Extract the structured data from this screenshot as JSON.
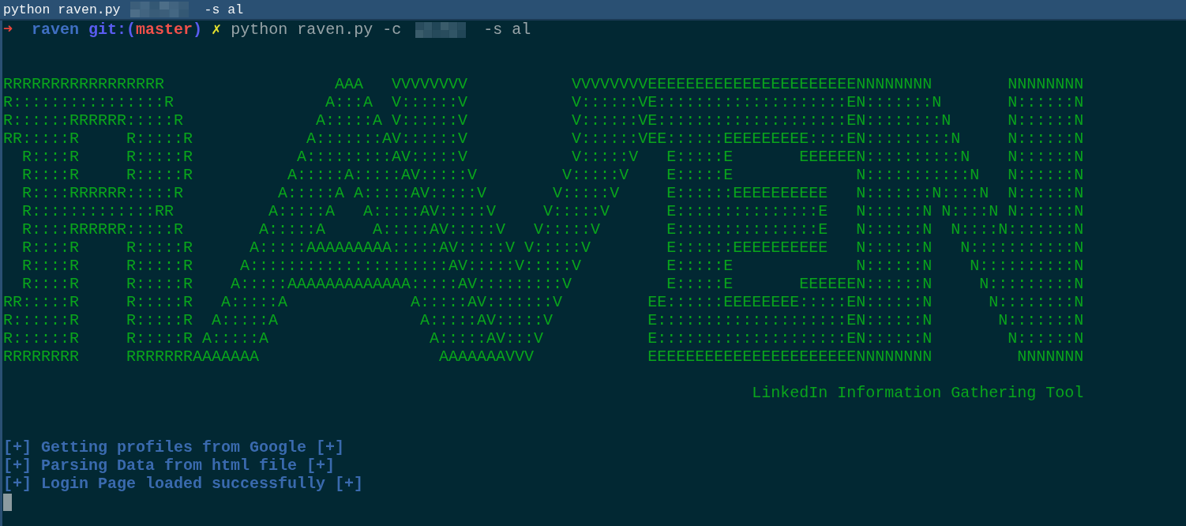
{
  "title_bar": {
    "segments": [
      {
        "kind": "text",
        "text": "python raven.py"
      },
      {
        "kind": "redacted"
      },
      {
        "kind": "text",
        "text": "-s al"
      }
    ]
  },
  "prompt": {
    "arrow": "➜",
    "directory": "raven",
    "git_prefix": "git:(",
    "branch": "master",
    "git_suffix": ")",
    "dirty_mark": "✗",
    "command": [
      {
        "kind": "text",
        "text": "python raven.py -c"
      },
      {
        "kind": "redacted"
      },
      {
        "kind": "text",
        "text": "-s al"
      }
    ]
  },
  "output": [
    {
      "kind": "blank"
    },
    {
      "kind": "blank"
    },
    {
      "kind": "art",
      "text": "RRRRRRRRRRRRRRRRR                  AAA   VVVVVVVV           VVVVVVVVEEEEEEEEEEEEEEEEEEEEEENNNNNNNN        NNNNNNNN"
    },
    {
      "kind": "art",
      "text": "R::::::::::::::::R                A:::A  V::::::V           V::::::VE::::::::::::::::::::EN:::::::N       N::::::N"
    },
    {
      "kind": "art",
      "text": "R::::::RRRRRR:::::R              A:::::A V::::::V           V::::::VE::::::::::::::::::::EN::::::::N      N::::::N"
    },
    {
      "kind": "art",
      "text": "RR:::::R     R:::::R            A:::::::AV::::::V           V::::::VEE::::::EEEEEEEEE::::EN:::::::::N     N::::::N"
    },
    {
      "kind": "art",
      "text": "  R::::R     R:::::R           A:::::::::AV:::::V           V:::::V   E:::::E       EEEEEEN::::::::::N    N::::::N"
    },
    {
      "kind": "art",
      "text": "  R::::R     R:::::R          A:::::A:::::AV:::::V         V:::::V    E:::::E             N:::::::::::N   N::::::N"
    },
    {
      "kind": "art",
      "text": "  R::::RRRRRR:::::R          A:::::A A:::::AV:::::V       V:::::V     E::::::EEEEEEEEEE   N:::::::N::::N  N::::::N"
    },
    {
      "kind": "art",
      "text": "  R:::::::::::::RR          A:::::A   A:::::AV:::::V     V:::::V      E:::::::::::::::E   N::::::N N::::N N::::::N"
    },
    {
      "kind": "art",
      "text": "  R::::RRRRRR:::::R        A:::::A     A:::::AV:::::V   V:::::V       E:::::::::::::::E   N::::::N  N::::N:::::::N"
    },
    {
      "kind": "art",
      "text": "  R::::R     R:::::R      A:::::AAAAAAAAA:::::AV:::::V V:::::V        E::::::EEEEEEEEEE   N::::::N   N:::::::::::N"
    },
    {
      "kind": "art",
      "text": "  R::::R     R:::::R     A:::::::::::::::::::::AV:::::V:::::V         E:::::E             N::::::N    N::::::::::N"
    },
    {
      "kind": "art",
      "text": "  R::::R     R:::::R    A:::::AAAAAAAAAAAAA:::::AV:::::::::V          E:::::E       EEEEEEN::::::N     N:::::::::N"
    },
    {
      "kind": "art",
      "text": "RR:::::R     R:::::R   A:::::A             A:::::AV:::::::V         EE::::::EEEEEEEE:::::EN::::::N      N::::::::N"
    },
    {
      "kind": "art",
      "text": "R::::::R     R:::::R  A:::::A               A:::::AV:::::V          E::::::::::::::::::::EN::::::N       N:::::::N"
    },
    {
      "kind": "art",
      "text": "R::::::R     R:::::R A:::::A                 A:::::AV:::V           E::::::::::::::::::::EN::::::N        N::::::N"
    },
    {
      "kind": "art",
      "text": "RRRRRRRR     RRRRRRRAAAAAAA                   AAAAAAAVVV            EEEEEEEEEEEEEEEEEEEEEENNNNNNNN         NNNNNNN"
    },
    {
      "kind": "blank"
    },
    {
      "kind": "tagline",
      "text": "LinkedIn Information Gathering Tool"
    },
    {
      "kind": "blank"
    },
    {
      "kind": "blank"
    },
    {
      "kind": "status",
      "text": "[+] Getting profiles from Google [+]"
    },
    {
      "kind": "status",
      "text": "[+] Parsing Data from html file [+]"
    },
    {
      "kind": "status",
      "text": "[+] Login Page loaded successfully [+]"
    },
    {
      "kind": "cursor"
    }
  ]
}
